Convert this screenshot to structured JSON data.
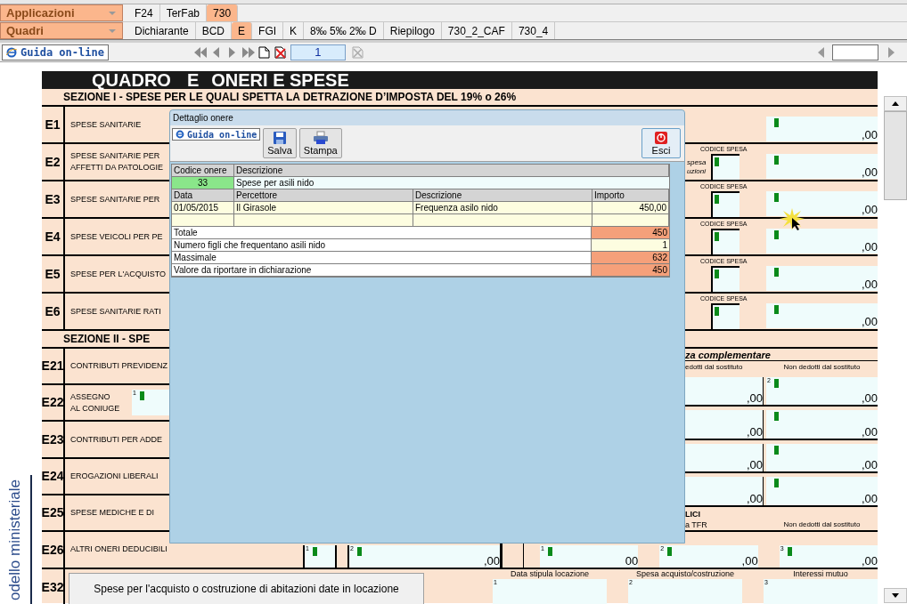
{
  "app_bar": {
    "applications": {
      "label": "Applicazioni"
    },
    "app_tabs": [
      {
        "label": "F24",
        "selected": false
      },
      {
        "label": "TerFab",
        "selected": false
      },
      {
        "label": "730",
        "selected": true
      }
    ],
    "sections": {
      "label": "Quadri"
    },
    "section_tabs": [
      {
        "label": "Dichiarante",
        "selected": false
      },
      {
        "label": "BCD",
        "selected": false
      },
      {
        "label": "E",
        "selected": true
      },
      {
        "label": "FGI",
        "selected": false
      },
      {
        "label": "K",
        "selected": false
      },
      {
        "label": "8‰ 5‰ 2‰ D",
        "selected": false
      },
      {
        "label": "Riepilogo",
        "selected": false
      },
      {
        "label": "730_2_CAF",
        "selected": false
      },
      {
        "label": "730_4",
        "selected": false
      }
    ]
  },
  "toolbar": {
    "help_button": "Guida on-line",
    "page": "1"
  },
  "form": {
    "side_label": "odello ministeriale",
    "title": {
      "prefix": "QUADRO",
      "letter": "E",
      "name": "ONERI E SPESE"
    },
    "section_1": {
      "heading": "SEZIONE I -  SPESE PER LE QUALI SPETTA LA DETRAZIONE D’IMPOSTA DEL 19% o 26%",
      "rows": [
        {
          "code": "E1",
          "label": [
            "SPESE SANITARIE"
          ],
          "kind": "amount",
          "amount": ",00"
        },
        {
          "code": "E2",
          "label": [
            "SPESE SANITARIE PER",
            "AFFETTI DA PATOLOGIE"
          ],
          "kind": "code_amount",
          "code_label": "CODICE SPESA",
          "note": [
            "spesa",
            "uzioni"
          ],
          "amount": ",00"
        },
        {
          "code": "E3",
          "label": [
            "SPESE SANITARIE PER"
          ],
          "kind": "code_amount",
          "code_label": "CODICE SPESA",
          "amount": ",00"
        },
        {
          "code": "E4",
          "label": [
            "SPESE VEICOLI PER PE"
          ],
          "kind": "code_amount",
          "code_label": "CODICE SPESA",
          "amount": ",00"
        },
        {
          "code": "E5",
          "label": [
            "SPESE PER L'ACQUISTO"
          ],
          "kind": "code_amount",
          "code_label": "CODICE SPESA",
          "amount": ",00"
        },
        {
          "code": "E6",
          "label": [
            "SPESE SANITARIE RATI"
          ],
          "kind": "code_amount",
          "code_label": "CODICE SPESA",
          "amount": ",00"
        }
      ]
    },
    "section_2": {
      "heading": "SEZIONE II - SPE",
      "rows": [
        {
          "code": "E21",
          "label": [
            "CONTRIBUTI PREVIDENZ"
          ],
          "kind": "plain"
        },
        {
          "code": "E22",
          "label": [
            "ASSEGNO",
            "AL CONIUGE"
          ],
          "kind": "field",
          "field": {
            "index": "1",
            "marker": true
          }
        },
        {
          "code": "E23",
          "label": [
            "CONTRIBUTI PER ADDE"
          ],
          "kind": "plain"
        },
        {
          "code": "E24",
          "label": [
            "EROGAZIONI LIBERALI"
          ],
          "kind": "plain"
        },
        {
          "code": "E25",
          "label": [
            "SPESE MEDICHE E DI"
          ],
          "kind": "plain"
        }
      ],
      "subheading": "za complementare",
      "col_heads": [
        "edotti dal sostituto",
        "Non dedotti dal sostituto"
      ],
      "field_rows": [
        {
          "fields": [
            {
              "amount": ",00",
              "marker": false
            },
            {
              "index": "2",
              "amount": ",00",
              "marker": true
            }
          ]
        },
        {
          "fields": [
            {
              "amount": ",00",
              "marker": false
            },
            {
              "amount": ",00",
              "marker": true
            }
          ]
        },
        {
          "fields": [
            {
              "amount": ",00",
              "marker": false
            },
            {
              "amount": ",00",
              "marker": true
            }
          ]
        },
        {
          "fields": [
            {
              "amount": ",00",
              "marker": false
            },
            {
              "amount": ",00",
              "marker": true
            }
          ]
        }
      ],
      "group_heads": [
        "LICI",
        "a TFR",
        "Non dedotti dal sostituto"
      ]
    },
    "row_e26": {
      "code": "E26",
      "label": "ALTRI ONERI DEDUCIBILI",
      "left_fields": [
        {
          "index": "1",
          "marker": true
        },
        {
          "index": "2",
          "marker": true,
          "amount": ",00"
        }
      ],
      "right_fields": [
        {
          "index": "1",
          "marker": true,
          "amount": "00"
        },
        {
          "index": "2",
          "marker": true,
          "amount": ",00"
        },
        {
          "index": "3",
          "marker": true,
          "amount": ",00"
        }
      ]
    },
    "row_e32": {
      "code": "E32",
      "button": "Spese per l'acquisto o costruzione di abitazioni date in locazione",
      "fields": [
        {
          "label": "Data stipula locazione",
          "index": "1"
        },
        {
          "label": "Spesa acquisto/costruzione",
          "index": "2"
        },
        {
          "label": "Interessi mutuo",
          "index": "3"
        }
      ]
    }
  },
  "dialog": {
    "title": "Dettaglio onere",
    "help_button": "Guida on-line",
    "actions": [
      {
        "label": "Salva",
        "kind": "save"
      },
      {
        "label": "Stampa",
        "kind": "print"
      }
    ],
    "exit": {
      "label": "Esci"
    },
    "header_row": [
      "Codice onere",
      "Descrizione"
    ],
    "onere": {
      "code": "33",
      "description": "Spese per asili nido"
    },
    "columns": [
      "Data",
      "Percettore",
      "Descrizione",
      "Importo"
    ],
    "rows": [
      {
        "cells": [
          "01/05/2015",
          "Il Girasole",
          "Frequenza asilo nido",
          "450,00"
        ]
      }
    ],
    "summary": [
      {
        "label": "Totale",
        "value": "450",
        "kind": "computed"
      },
      {
        "label": "Numero figli che frequentano asili nido",
        "value": "1",
        "kind": "input"
      },
      {
        "label": "Massimale",
        "value": "632",
        "kind": "computed"
      },
      {
        "label": "Valore da riportare in dichiarazione",
        "value": "450",
        "kind": "computed"
      }
    ]
  }
}
